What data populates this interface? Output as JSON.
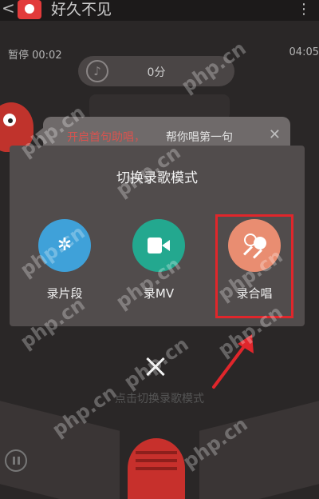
{
  "header": {
    "song_title": "好久不见",
    "back_icon": "back-arrow-icon",
    "more_icon": "more-vertical-icon"
  },
  "status": {
    "pause_time": "暂停 00:02",
    "total_time": "04:05",
    "score": "0分"
  },
  "hint": {
    "text": "开启首句助唱，",
    "link": "帮你唱第一句",
    "close": "✕"
  },
  "dialog": {
    "title": "切换录歌模式",
    "modes": [
      {
        "label": "录片段",
        "icon": "clip-icon",
        "color": "#3fa1d9"
      },
      {
        "label": "录MV",
        "icon": "camera-icon",
        "color": "#23a88f"
      },
      {
        "label": "录合唱",
        "icon": "duet-microphone-icon",
        "color": "#e98d71"
      }
    ],
    "highlight_color": "#e0262b"
  },
  "bottom": {
    "caption": "点击切换录歌模式"
  },
  "watermark": "php.cn"
}
